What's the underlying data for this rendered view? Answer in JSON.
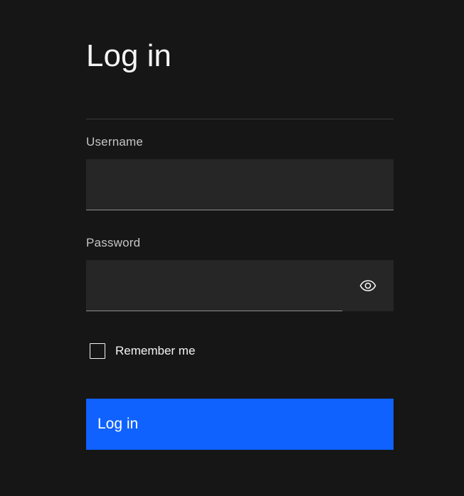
{
  "page": {
    "title": "Log in"
  },
  "username": {
    "label": "Username",
    "value": "",
    "placeholder": ""
  },
  "password": {
    "label": "Password",
    "value": "",
    "placeholder": "",
    "toggle_icon": "eye-icon"
  },
  "remember": {
    "label": "Remember me",
    "checked": false
  },
  "submit": {
    "label": "Log in"
  },
  "colors": {
    "background": "#161616",
    "field": "#262626",
    "primary": "#0f62fe",
    "text": "#f4f4f4",
    "label": "#c6c6c6"
  }
}
